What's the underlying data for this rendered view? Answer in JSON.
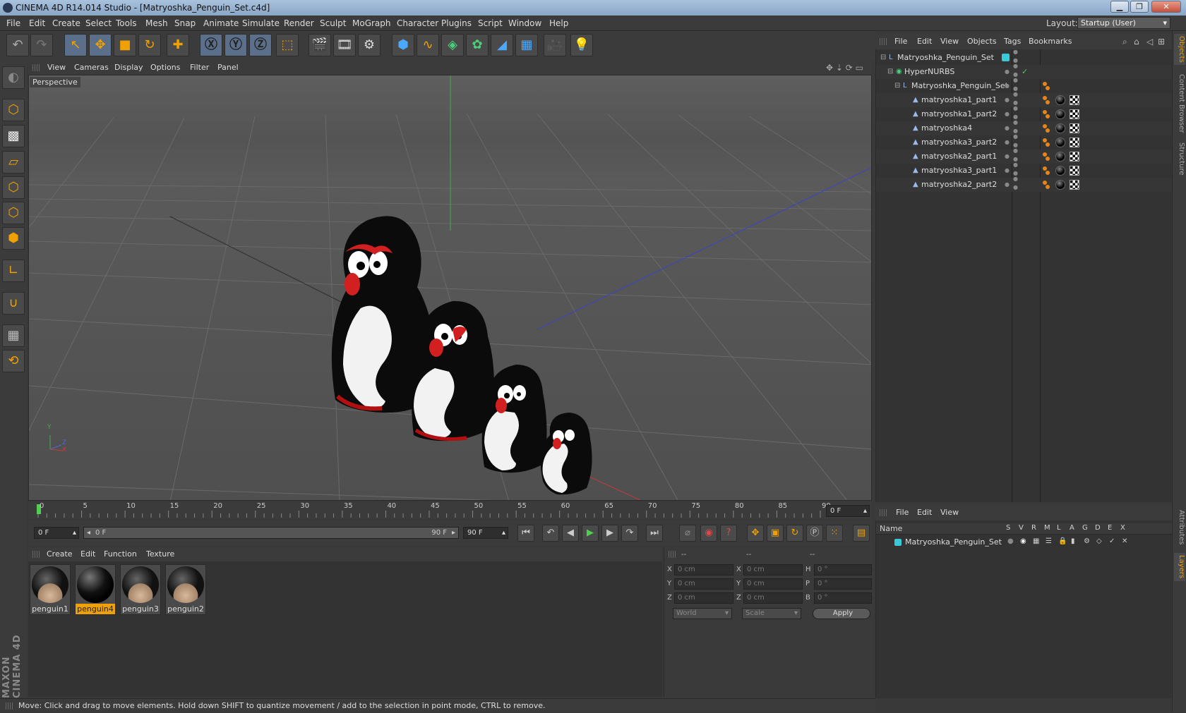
{
  "window": {
    "title": "CINEMA 4D R14.014 Studio - [Matryoshka_Penguin_Set.c4d]"
  },
  "menubar": {
    "items": [
      "File",
      "Edit",
      "Create",
      "Select",
      "Tools",
      "Mesh",
      "Snap",
      "Animate",
      "Simulate",
      "Render",
      "Sculpt",
      "MoGraph",
      "Character",
      "Plugins",
      "Script",
      "Window",
      "Help"
    ]
  },
  "layout": {
    "label": "Layout:",
    "value": "Startup (User)"
  },
  "viewport": {
    "menu": [
      "View",
      "Cameras",
      "Display",
      "Options",
      "Filter",
      "Panel"
    ],
    "label": "Perspective",
    "axes": {
      "y": "Y",
      "z": "Z",
      "x": "X"
    }
  },
  "timeline": {
    "ticks": [
      "0",
      "5",
      "10",
      "15",
      "20",
      "25",
      "30",
      "35",
      "40",
      "45",
      "50",
      "55",
      "60",
      "65",
      "70",
      "75",
      "80",
      "85",
      "90"
    ],
    "end_field": "0 F"
  },
  "transport": {
    "current_frame": "0 F",
    "range_start": "0 F",
    "range_end": "90 F",
    "max_frame": "90 F"
  },
  "materials": {
    "menu": [
      "Create",
      "Edit",
      "Function",
      "Texture"
    ],
    "items": [
      {
        "name": "penguin1",
        "selected": false
      },
      {
        "name": "penguin4",
        "selected": true
      },
      {
        "name": "penguin3",
        "selected": false
      },
      {
        "name": "penguin2",
        "selected": false
      }
    ]
  },
  "coordinates": {
    "headers": [
      "--",
      "--",
      "--"
    ],
    "rows": [
      {
        "a_label": "X",
        "a_val": "0 cm",
        "b_label": "X",
        "b_val": "0 cm",
        "c_label": "H",
        "c_val": "0 °"
      },
      {
        "a_label": "Y",
        "a_val": "0 cm",
        "b_label": "Y",
        "b_val": "0 cm",
        "c_label": "P",
        "c_val": "0 °"
      },
      {
        "a_label": "Z",
        "a_val": "0 cm",
        "b_label": "Z",
        "b_val": "0 cm",
        "c_label": "B",
        "c_val": "0 °"
      }
    ],
    "mode": "World",
    "size_mode": "Scale",
    "apply_label": "Apply"
  },
  "objects": {
    "menu": [
      "File",
      "Edit",
      "View",
      "Objects",
      "Tags",
      "Bookmarks"
    ],
    "tree": [
      {
        "name": "Matryoshka_Penguin_Set"
      },
      {
        "name": "HyperNURBS"
      },
      {
        "name": "Matryoshka_Penguin_Set"
      },
      {
        "name": "matryoshka1_part1"
      },
      {
        "name": "matryoshka1_part2"
      },
      {
        "name": "matryoshka4"
      },
      {
        "name": "matryoshka3_part2"
      },
      {
        "name": "matryoshka2_part1"
      },
      {
        "name": "matryoshka3_part1"
      },
      {
        "name": "matryoshka2_part2"
      }
    ]
  },
  "layers": {
    "menu": [
      "File",
      "Edit",
      "View"
    ],
    "columns": [
      "Name",
      "S",
      "V",
      "R",
      "M",
      "L",
      "A",
      "G",
      "D",
      "E",
      "X"
    ],
    "rows": [
      {
        "name": "Matryoshka_Penguin_Set"
      }
    ]
  },
  "sidetabs": [
    "Objects",
    "Content Browser",
    "Structure",
    "Attributes",
    "Layers"
  ],
  "brand": "MAXON CINEMA 4D",
  "status": "Move: Click and drag to move elements. Hold down SHIFT to quantize movement / add to the selection in point mode, CTRL to remove.",
  "colors": {
    "accent": "#f0a000",
    "layer": "#38c8d8",
    "selection": "#5b6f8a"
  }
}
